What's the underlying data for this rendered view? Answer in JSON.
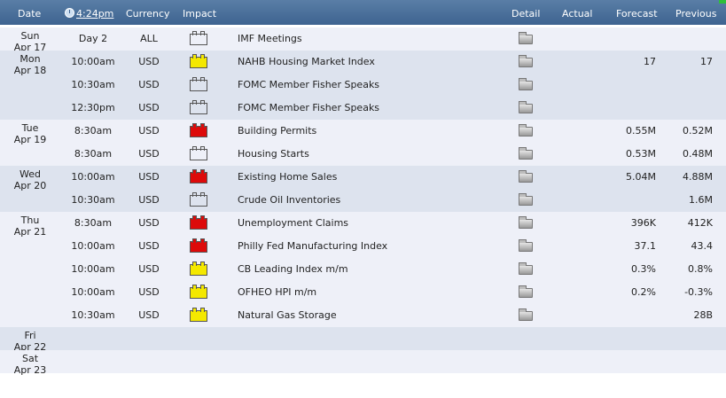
{
  "header": {
    "date": "Date",
    "time": "4:24pm",
    "currency": "Currency",
    "impact": "Impact",
    "detail": "Detail",
    "actual": "Actual",
    "forecast": "Forecast",
    "previous": "Previous"
  },
  "colors": {
    "header_bg": "#4a6f9a",
    "row_light": "#eef0f8",
    "row_dark": "#dde3ee",
    "impact_low": "#f4e800",
    "impact_medium": "#f49a4a",
    "impact_high": "#dd0a0a"
  },
  "days": [
    {
      "day": "Sun",
      "date": "Apr 17",
      "events": [
        {
          "time": "Day 2",
          "currency": "ALL",
          "impact": "medium",
          "event": "IMF Meetings",
          "actual": "",
          "forecast": "",
          "previous": ""
        }
      ]
    },
    {
      "day": "Mon",
      "date": "Apr 18",
      "events": [
        {
          "time": "10:00am",
          "currency": "USD",
          "impact": "low",
          "event": "NAHB Housing Market Index",
          "actual": "",
          "forecast": "17",
          "previous": "17"
        },
        {
          "time": "10:30am",
          "currency": "USD",
          "impact": "medium",
          "event": "FOMC Member Fisher Speaks",
          "actual": "",
          "forecast": "",
          "previous": ""
        },
        {
          "time": "12:30pm",
          "currency": "USD",
          "impact": "medium",
          "event": "FOMC Member Fisher Speaks",
          "actual": "",
          "forecast": "",
          "previous": ""
        }
      ]
    },
    {
      "day": "Tue",
      "date": "Apr 19",
      "events": [
        {
          "time": "8:30am",
          "currency": "USD",
          "impact": "high",
          "event": "Building Permits",
          "actual": "",
          "forecast": "0.55M",
          "previous": "0.52M"
        },
        {
          "time": "8:30am",
          "currency": "USD",
          "impact": "medium",
          "event": "Housing Starts",
          "actual": "",
          "forecast": "0.53M",
          "previous": "0.48M"
        }
      ]
    },
    {
      "day": "Wed",
      "date": "Apr 20",
      "events": [
        {
          "time": "10:00am",
          "currency": "USD",
          "impact": "high",
          "event": "Existing Home Sales",
          "actual": "",
          "forecast": "5.04M",
          "previous": "4.88M"
        },
        {
          "time": "10:30am",
          "currency": "USD",
          "impact": "medium",
          "event": "Crude Oil Inventories",
          "actual": "",
          "forecast": "",
          "previous": "1.6M"
        }
      ]
    },
    {
      "day": "Thu",
      "date": "Apr 21",
      "events": [
        {
          "time": "8:30am",
          "currency": "USD",
          "impact": "high",
          "event": "Unemployment Claims",
          "actual": "",
          "forecast": "396K",
          "previous": "412K"
        },
        {
          "time": "10:00am",
          "currency": "USD",
          "impact": "high",
          "event": "Philly Fed Manufacturing Index",
          "actual": "",
          "forecast": "37.1",
          "previous": "43.4"
        },
        {
          "time": "10:00am",
          "currency": "USD",
          "impact": "low",
          "event": "CB Leading Index m/m",
          "actual": "",
          "forecast": "0.3%",
          "previous": "0.8%"
        },
        {
          "time": "10:00am",
          "currency": "USD",
          "impact": "low",
          "event": "OFHEO HPI m/m",
          "actual": "",
          "forecast": "0.2%",
          "previous": "-0.3%"
        },
        {
          "time": "10:30am",
          "currency": "USD",
          "impact": "low",
          "event": "Natural Gas Storage",
          "actual": "",
          "forecast": "",
          "previous": "28B"
        }
      ]
    },
    {
      "day": "Fri",
      "date": "Apr 22",
      "events": []
    },
    {
      "day": "Sat",
      "date": "Apr 23",
      "events": []
    }
  ]
}
